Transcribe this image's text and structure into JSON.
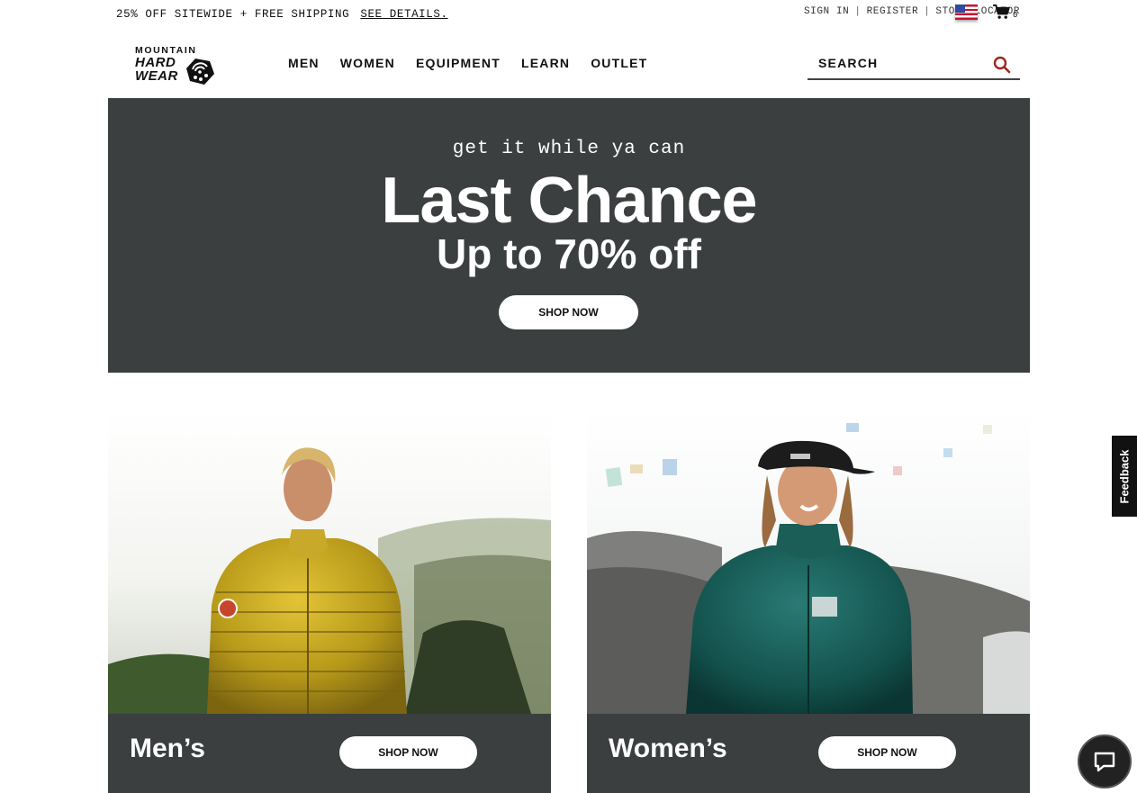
{
  "topbar": {
    "promo_text": "25% OFF SITEWIDE + FREE SHIPPING",
    "promo_link": "SEE DETAILS.",
    "sign_in": "SIGN IN",
    "register": "REGISTER",
    "store_locator": "STORE LOCATOR",
    "separator": "|",
    "cart_count": "0",
    "flag_icon": "us-flag-icon",
    "cart_icon": "cart-icon"
  },
  "header": {
    "logo_line1": "MOUNTAIN",
    "logo_line2": "HARD",
    "logo_line3": "WEAR",
    "nav": [
      "MEN",
      "WOMEN",
      "EQUIPMENT",
      "LEARN",
      "OUTLET"
    ],
    "search_placeholder": "SEARCH",
    "search_icon": "search-icon",
    "search_icon_color": "#9b2a1e"
  },
  "hero": {
    "eyebrow": "get it while ya can",
    "title": "Last Chance",
    "subtitle": "Up to 70% off",
    "cta": "SHOP NOW",
    "bg_color": "#3b3f40"
  },
  "categories": [
    {
      "label": "Men’s",
      "cta": "SHOP NOW"
    },
    {
      "label": "Women’s",
      "cta": "SHOP NOW"
    }
  ],
  "feedback_label": "Feedback",
  "chat_icon": "chat-icon"
}
